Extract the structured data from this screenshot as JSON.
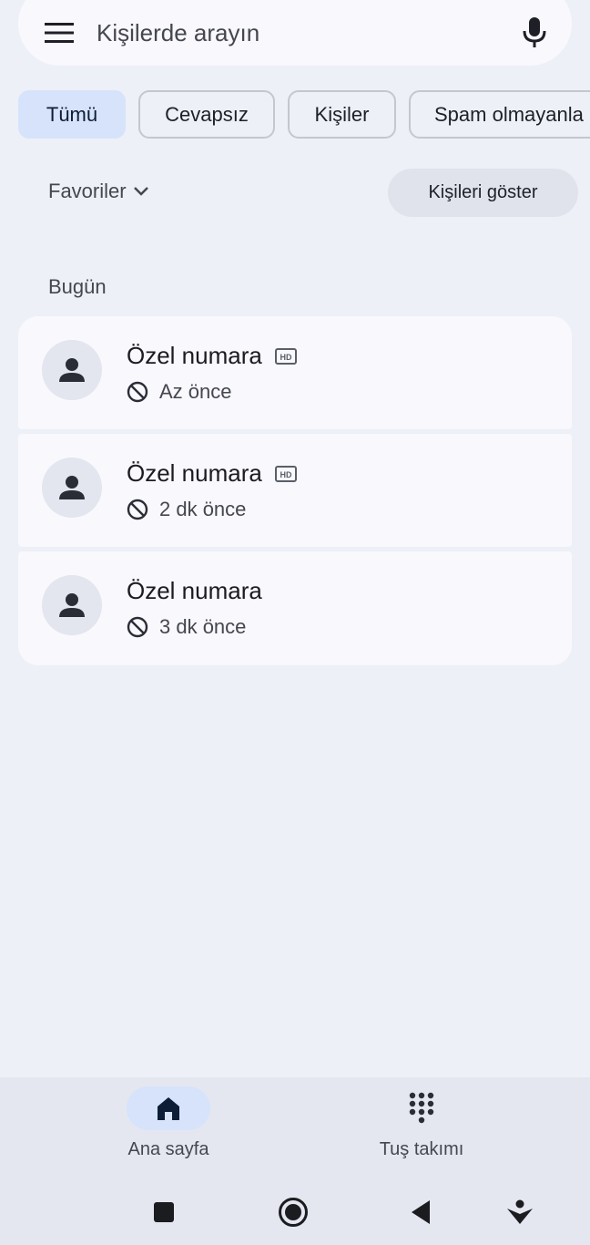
{
  "search": {
    "placeholder": "Kişilerde arayın",
    "menu_icon": "menu-icon",
    "mic_icon": "mic-icon"
  },
  "filters": [
    {
      "label": "Tümü",
      "selected": true
    },
    {
      "label": "Cevapsız",
      "selected": false
    },
    {
      "label": "Kişiler",
      "selected": false
    },
    {
      "label": "Spam olmayanla",
      "selected": false
    }
  ],
  "favorites": {
    "label": "Favoriler",
    "show_contacts_button": "Kişileri göster"
  },
  "section": {
    "today": "Bugün"
  },
  "calls": [
    {
      "name": "Özel numara",
      "hd": true,
      "time": "Az önce",
      "status_icon": "blocked-icon"
    },
    {
      "name": "Özel numara",
      "hd": true,
      "time": "2 dk önce",
      "status_icon": "blocked-icon"
    },
    {
      "name": "Özel numara",
      "hd": false,
      "time": "3 dk önce",
      "status_icon": "blocked-icon"
    }
  ],
  "bottom_nav": {
    "home": {
      "label": "Ana sayfa",
      "icon": "home-icon",
      "active": true
    },
    "keypad": {
      "label": "Tuş takımı",
      "icon": "dialpad-icon",
      "active": false
    }
  },
  "colors": {
    "background": "#eef0f8",
    "card": "#f8f8fd",
    "chip_active": "#d6e3fb",
    "accent_text": "#0e1d36"
  }
}
